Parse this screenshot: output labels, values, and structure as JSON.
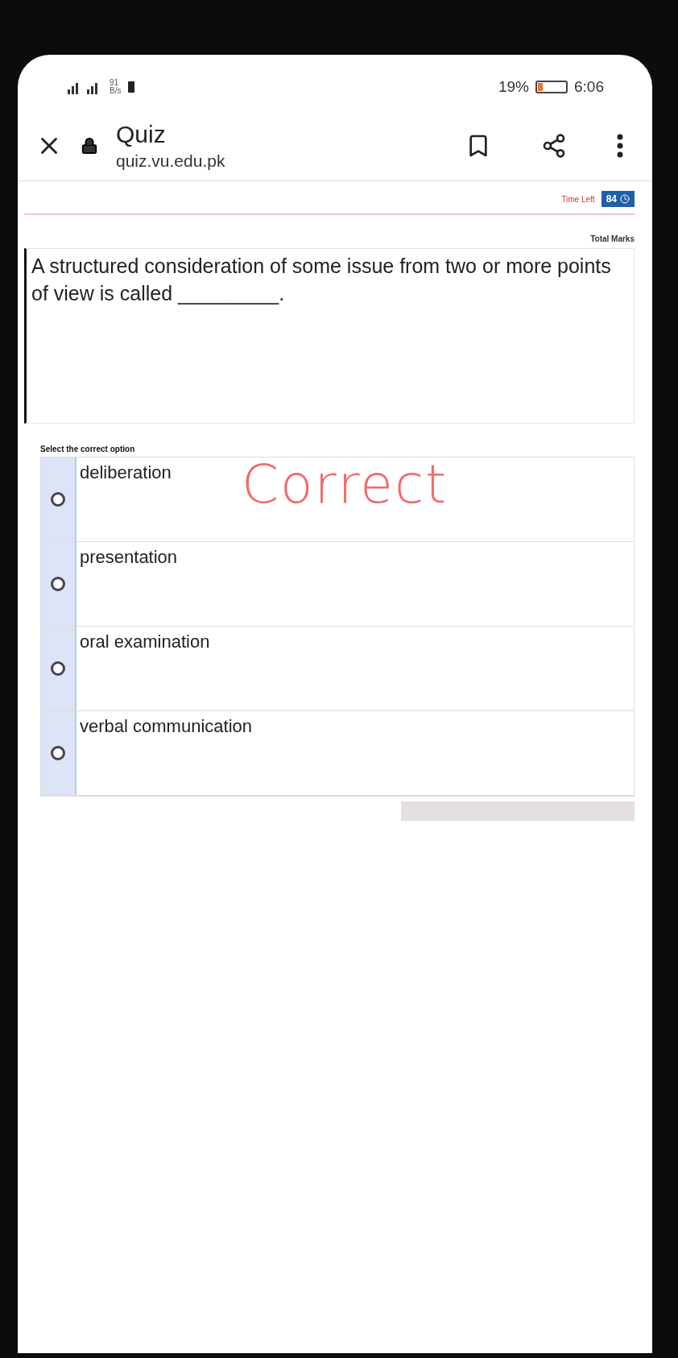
{
  "status_bar": {
    "data_rate": "91",
    "data_unit": "B/s",
    "battery": "19%",
    "time": "6:06"
  },
  "browser_bar": {
    "title": "Quiz",
    "url": "quiz.vu.edu.pk"
  },
  "quiz": {
    "time_left_label": "Time Left",
    "time_left": "84",
    "total_marks_label": "Total Marks",
    "question": "A structured consideration of some issue from two or more points of view is called",
    "blank": "_________.",
    "instruction": "Select the correct option",
    "options": [
      {
        "label": "deliberation",
        "selected": false
      },
      {
        "label": "presentation",
        "selected": false
      },
      {
        "label": "oral examination",
        "selected": false
      },
      {
        "label": "verbal communication",
        "selected": false
      }
    ],
    "annotation": "Correct"
  }
}
